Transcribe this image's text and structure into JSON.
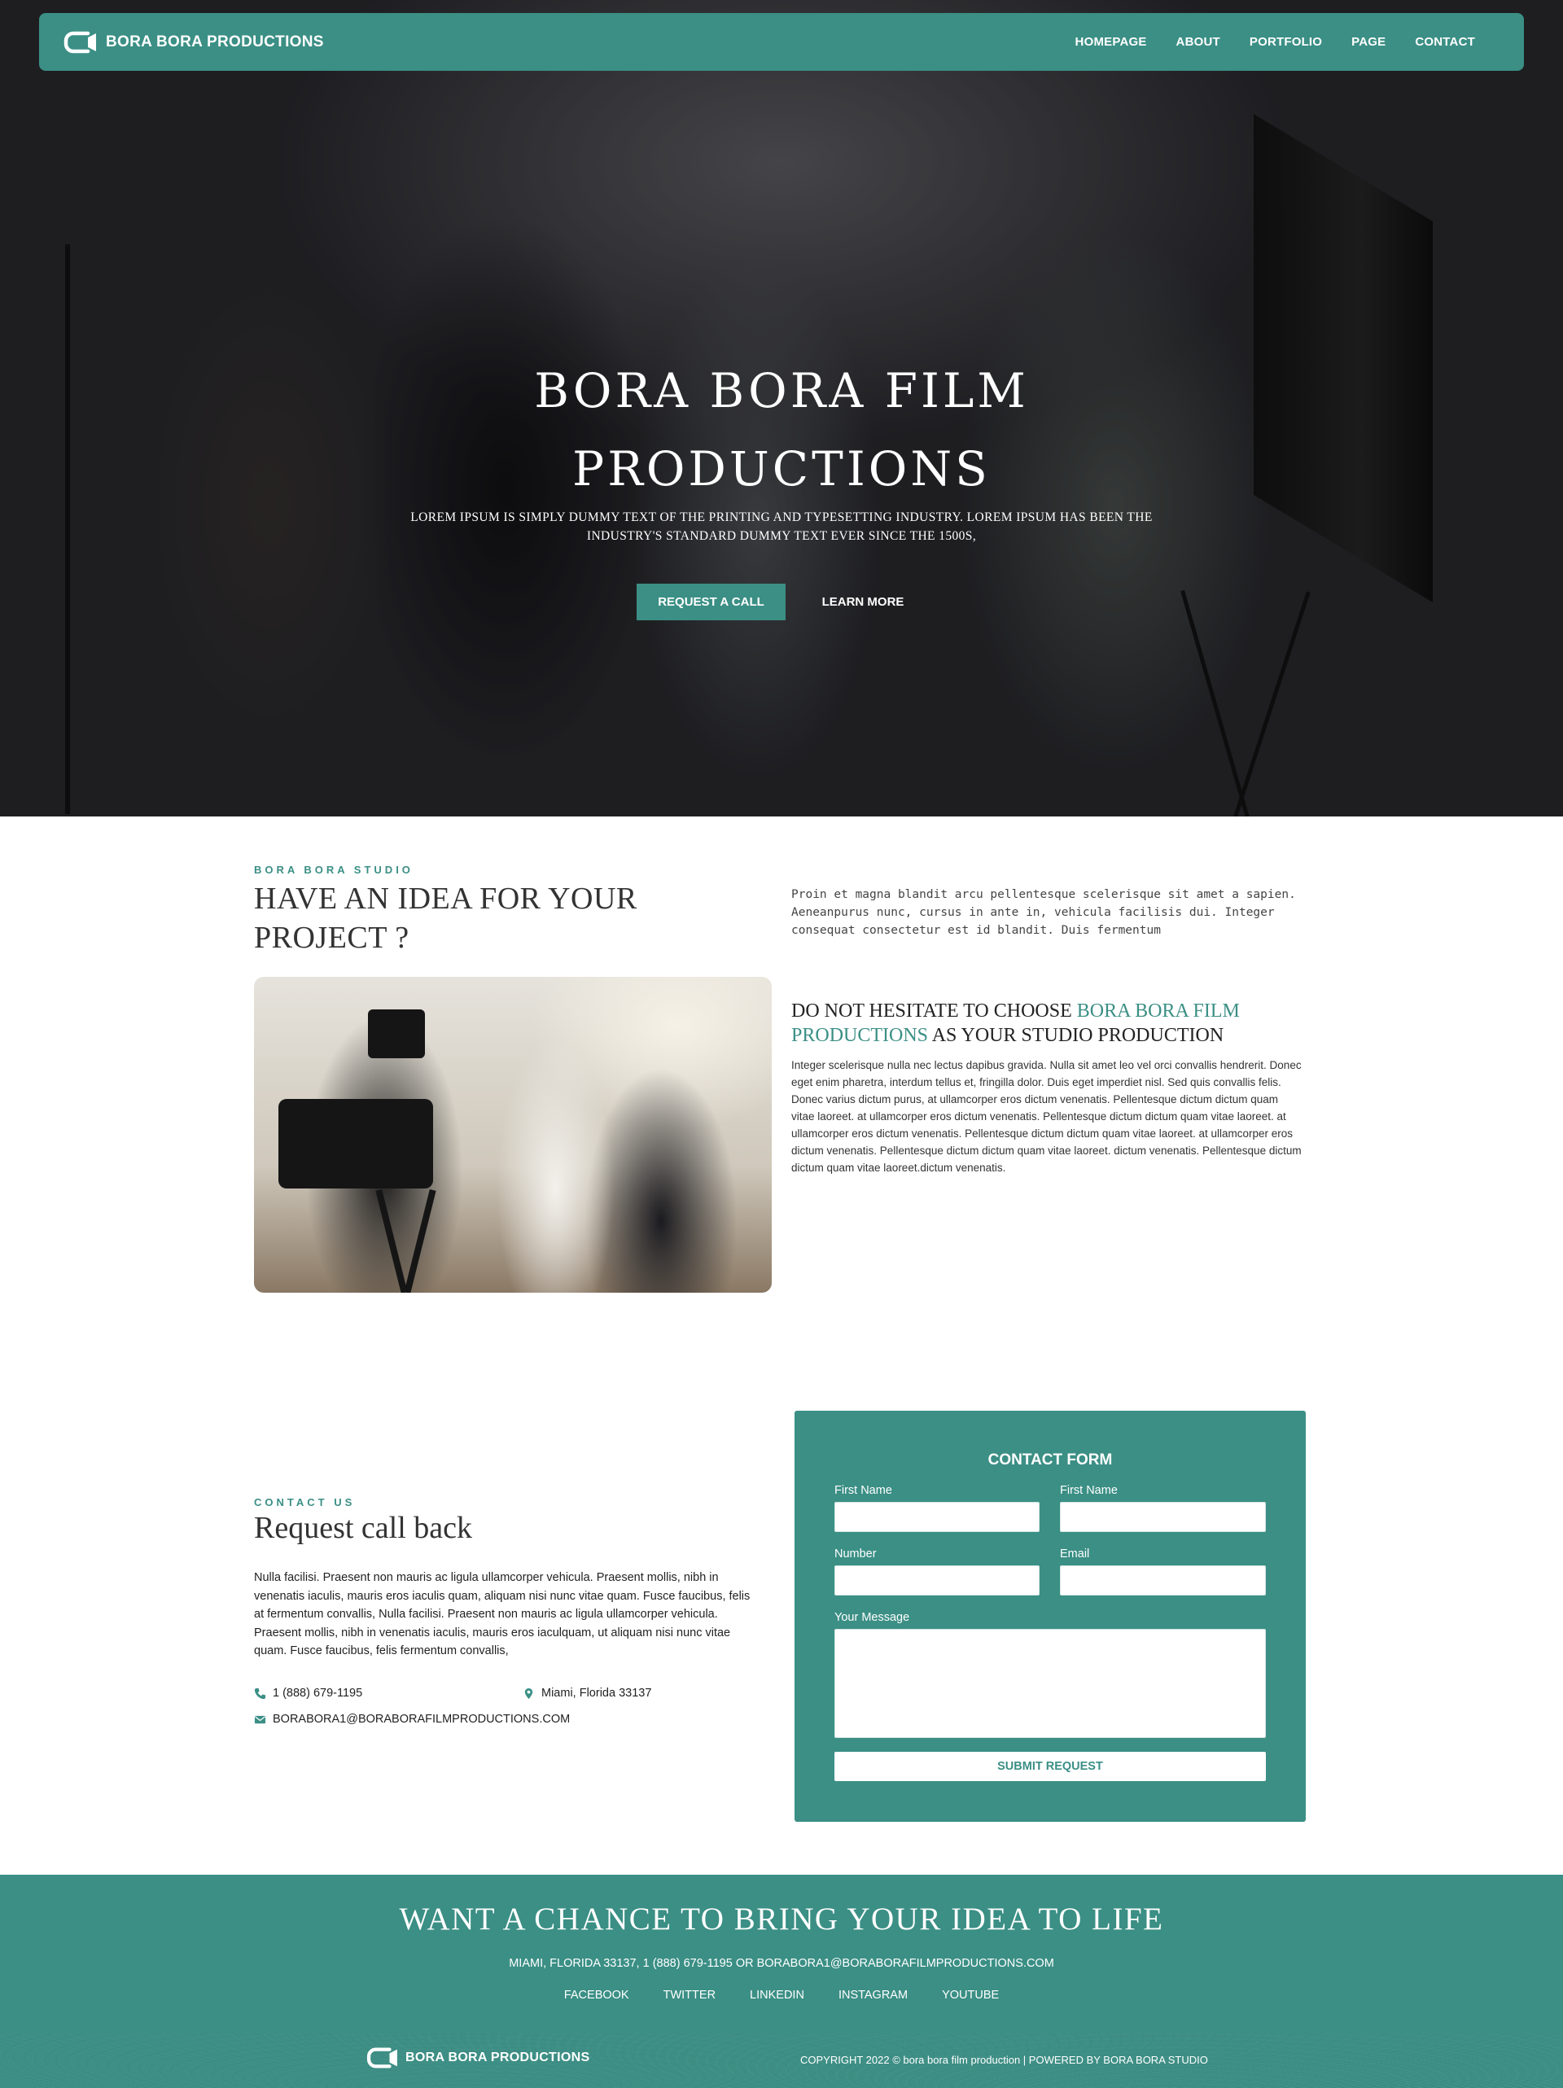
{
  "brand": {
    "name": "BORA BORA PRODUCTIONS",
    "logo_icon": "camera-logo-icon"
  },
  "nav": {
    "items": [
      {
        "label": "HOMEPAGE"
      },
      {
        "label": "ABOUT"
      },
      {
        "label": "PORTFOLIO"
      },
      {
        "label": "PAGE"
      },
      {
        "label": "CONTACT"
      }
    ]
  },
  "hero": {
    "title_line1": "BORA BORA FILM",
    "title_line2": "PRODUCTIONS",
    "subtitle": "Lorem Ipsum is simply dummy text of the printing and typesetting industry. Lorem Ipsum has been the industry's standard dummy text ever since the 1500s,",
    "primary_button": "REQUEST A CALL",
    "secondary_button": "LEARN MORE"
  },
  "about": {
    "eyebrow": "BORA BORA STUDIO",
    "heading": "HAVE AN IDEA FOR YOUR PROJECT ?",
    "intro": "Proin et magna blandit arcu pellentesque scelerisque sit amet a sapien. Aeneanpurus nunc, cursus in ante in, vehicula facilisis dui. Integer consequat consectetur est id blandit. Duis fermentum",
    "choose_prefix": "DO NOT HESITATE TO CHOOSE ",
    "choose_accent": "BORA BORA FILM PRODUCTIONS",
    "choose_suffix": " AS YOUR STUDIO PRODUCTION",
    "body": "Integer scelerisque nulla nec lectus dapibus gravida. Nulla sit amet leo vel orci convallis hendrerit. Donec eget enim pharetra, interdum tellus et, fringilla dolor. Duis eget imperdiet nisl. Sed quis convallis felis. Donec varius dictum purus, at ullamcorper eros dictum venenatis. Pellentesque dictum dictum quam vitae laoreet. at ullamcorper eros dictum venenatis. Pellentesque dictum dictum quam vitae laoreet. at ullamcorper eros dictum venenatis. Pellentesque dictum dictum quam vitae laoreet. at ullamcorper eros dictum venenatis. Pellentesque dictum dictum quam vitae laoreet. dictum venenatis. Pellentesque dictum dictum quam vitae laoreet.dictum venenatis."
  },
  "contact": {
    "eyebrow": "CONTACT US",
    "heading": "Request call back",
    "body": "Nulla facilisi. Praesent non mauris ac ligula ullamcorper vehicula. Praesent mollis, nibh in venenatis iaculis, mauris eros iaculis quam, aliquam nisi nunc vitae quam. Fusce faucibus, felis at fermentum convallis, Nulla facilisi. Praesent non mauris ac ligula ullamcorper vehicula. Praesent mollis, nibh in venenatis iaculis, mauris eros iaculquam, ut aliquam nisi nunc vitae quam. Fusce faucibus, felis fermentum convallis,",
    "phone": "1 (888) 679-1195",
    "location": "Miami, Florida 33137",
    "email": "BORABORA1@BORABORAFILMPRODUCTIONS.COM"
  },
  "form": {
    "title": "CONTACT FORM",
    "field1_label": "First Name",
    "field2_label": "First Name",
    "field3_label": "Number",
    "field4_label": "Email",
    "message_label": "Your Message",
    "submit": "SUBMIT REQUEST"
  },
  "footer": {
    "title": "WANT A CHANCE TO BRING YOUR IDEA TO LIFE",
    "contact_line": "MIAMI, FLORIDA 33137, 1 (888) 679-1195 OR BORABORA1@BORABORAFILMPRODUCTIONS.COM",
    "social": [
      {
        "label": "FACEBOOK"
      },
      {
        "label": "TWITTER"
      },
      {
        "label": "LINKEDIN"
      },
      {
        "label": "INSTAGRAM"
      },
      {
        "label": "YOUTUBE"
      }
    ],
    "brand_name": "BORA BORA PRODUCTIONS",
    "copyright": "COPYRIGHT 2022 © bora bora film production | POWERED BY BORA BORA STUDIO"
  },
  "colors": {
    "accent": "#3b8f85",
    "text": "#222222",
    "white": "#ffffff"
  }
}
